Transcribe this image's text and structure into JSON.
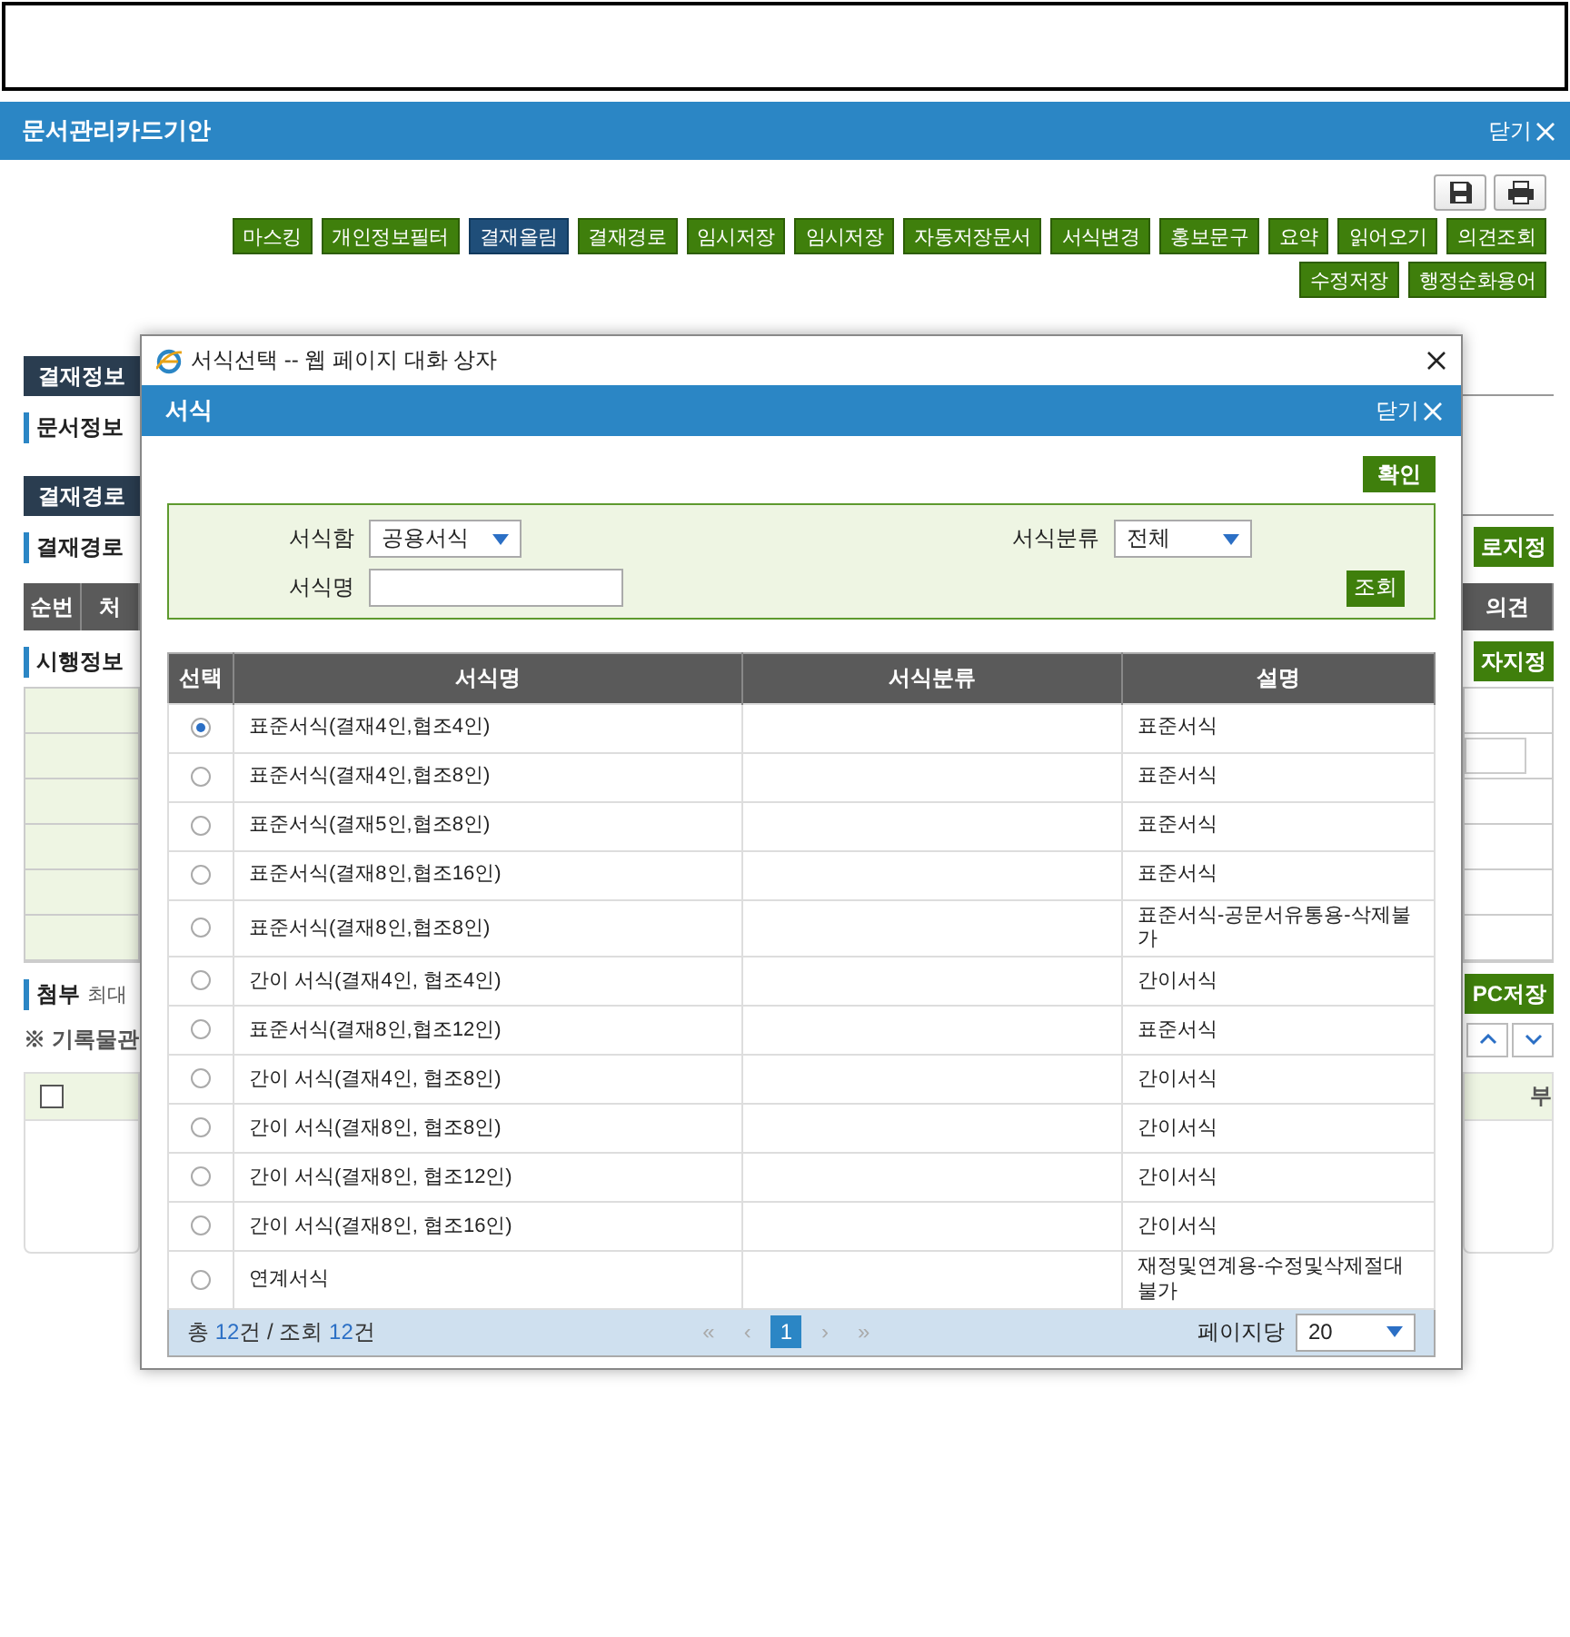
{
  "window": {
    "title": "문서관리카드기안",
    "close": "닫기"
  },
  "action_rows": [
    [
      {
        "label": "마스킹",
        "selected": false
      },
      {
        "label": "개인정보필터",
        "selected": false
      },
      {
        "label": "결재올림",
        "selected": true
      },
      {
        "label": "결재경로",
        "selected": false
      },
      {
        "label": "임시저장",
        "selected": false
      },
      {
        "label": "임시저장",
        "selected": false
      },
      {
        "label": "자동저장문서",
        "selected": false
      },
      {
        "label": "서식변경",
        "selected": false
      },
      {
        "label": "홍보문구",
        "selected": false
      },
      {
        "label": "요약",
        "selected": false
      },
      {
        "label": "읽어오기",
        "selected": false
      },
      {
        "label": "의견조회",
        "selected": false
      }
    ],
    [
      {
        "label": "수정저장",
        "selected": false
      },
      {
        "label": "행정순화용어",
        "selected": false
      }
    ]
  ],
  "background_rows": [
    {
      "kind": "tab",
      "left": "결재정보"
    },
    {
      "kind": "heading",
      "left": "문서정보"
    },
    {
      "kind": "tab",
      "left": "결재경로"
    },
    {
      "kind": "heading",
      "left": "결재경로",
      "right": "로지정"
    },
    {
      "kind": "table_header",
      "left": [
        "순번",
        "처"
      ],
      "right": "의견"
    },
    {
      "kind": "heading",
      "left": "시행정보",
      "right": "자지정"
    },
    {
      "kind": "grid"
    },
    {
      "kind": "heading",
      "left": "첨부",
      "note": "최대",
      "right": "PC저장"
    },
    {
      "kind": "note",
      "left": "※ 기록물관"
    },
    {
      "kind": "file_table",
      "checked": false,
      "right": "부"
    }
  ],
  "dialog": {
    "title": "서식선택 -- 웹 페이지 대화 상자",
    "header": "서식",
    "close": "닫기",
    "confirm": "확인",
    "filters": {
      "box_label": "서식함",
      "box_value": "공용서식",
      "category_label": "서식분류",
      "category_value": "전체",
      "name_label": "서식명",
      "search": "조회"
    },
    "columns": [
      "선택",
      "서식명",
      "서식분류",
      "설명"
    ],
    "rows": [
      {
        "selected": true,
        "name": "표준서식(결재4인,협조4인)",
        "description": "표준서식"
      },
      {
        "selected": false,
        "name": "표준서식(결재4인,협조8인)",
        "description": "표준서식"
      },
      {
        "selected": false,
        "name": "표준서식(결재5인,협조8인)",
        "description": "표준서식"
      },
      {
        "selected": false,
        "name": "표준서식(결재8인,협조16인)",
        "description": "표준서식"
      },
      {
        "selected": false,
        "name": "표준서식(결재8인,협조8인)",
        "description": "표준서식-공문서유통용-삭제불가"
      },
      {
        "selected": false,
        "name": "간이 서식(결재4인, 협조4인)",
        "description": "간이서식"
      },
      {
        "selected": false,
        "name": "표준서식(결재8인,협조12인)",
        "description": "표준서식"
      },
      {
        "selected": false,
        "name": "간이 서식(결재4인, 협조8인)",
        "description": "간이서식"
      },
      {
        "selected": false,
        "name": "간이 서식(결재8인, 협조8인)",
        "description": "간이서식"
      },
      {
        "selected": false,
        "name": "간이 서식(결재8인, 협조12인)",
        "description": "간이서식"
      },
      {
        "selected": false,
        "name": "간이 서식(결재8인, 협조16인)",
        "description": "간이서식"
      },
      {
        "selected": false,
        "name": "연계서식",
        "description": "재정및연계용-수정및삭제절대불가"
      }
    ],
    "summary": [
      {
        "text": "총 ",
        "highlight": false
      },
      {
        "text": "12",
        "highlight": true
      },
      {
        "text": "건 / 조회 ",
        "highlight": false
      },
      {
        "text": "12",
        "highlight": true
      },
      {
        "text": "건",
        "highlight": false
      }
    ],
    "pager": [
      {
        "label": "«",
        "selected": false
      },
      {
        "label": "‹",
        "selected": false
      },
      {
        "label": "1",
        "selected": true
      },
      {
        "label": "›",
        "selected": false
      },
      {
        "label": "»",
        "selected": false
      }
    ],
    "page_size_label": "페이지당",
    "page_size": "20"
  }
}
